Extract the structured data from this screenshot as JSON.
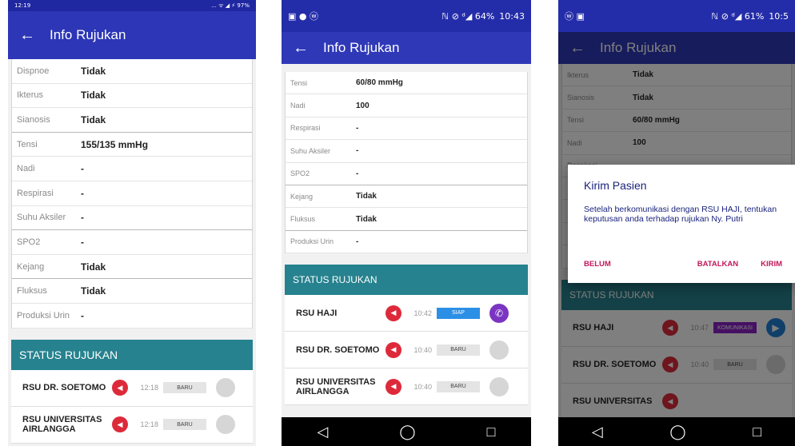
{
  "phone1": {
    "status_time": "12:19",
    "status_right": "... ᯤ ◢ ⚡ 97%",
    "title": "Info Rujukan",
    "rows": [
      {
        "label": "Dispnoe",
        "value": "Tidak"
      },
      {
        "label": "Ikterus",
        "value": "Tidak"
      },
      {
        "label": "Sianosis",
        "value": "Tidak"
      },
      {
        "label": "Tensi",
        "value": "155/135 mmHg"
      },
      {
        "label": "Nadi",
        "value": "-"
      },
      {
        "label": "Respirasi",
        "value": "-"
      },
      {
        "label": "Suhu Aksiler",
        "value": "-"
      },
      {
        "label": "SPO2",
        "value": "-"
      },
      {
        "label": "Kejang",
        "value": "Tidak"
      },
      {
        "label": "Fluksus",
        "value": "Tidak"
      },
      {
        "label": "Produksi Urin",
        "value": "-"
      }
    ],
    "status_header": "STATUS RUJUKAN",
    "hospitals": [
      {
        "name": "RSU DR. SOETOMO",
        "time": "12:18",
        "badge": "BARU"
      },
      {
        "name": "RSU UNIVERSITAS AIRLANGGA",
        "time": "12:18",
        "badge": "BARU"
      }
    ]
  },
  "phone2": {
    "status_time": "10:43",
    "status_left": "▣ ● ⓦ",
    "status_right": "ℕ ⊘ ᵈ◢ 64%",
    "title": "Info Rujukan",
    "rows": [
      {
        "label": "Tensi",
        "value": "60/80 mmHg"
      },
      {
        "label": "Nadi",
        "value": "100"
      },
      {
        "label": "Respirasi",
        "value": "-"
      },
      {
        "label": "Suhu Aksiler",
        "value": "-"
      },
      {
        "label": "SPO2",
        "value": "-"
      },
      {
        "label": "Kejang",
        "value": "Tidak"
      },
      {
        "label": "Fluksus",
        "value": "Tidak"
      },
      {
        "label": "Produksi Urin",
        "value": "-"
      }
    ],
    "status_header": "STATUS RUJUKAN",
    "hospitals": [
      {
        "name": "RSU HAJI",
        "time": "10:42",
        "badge": "SIAP"
      },
      {
        "name": "RSU DR. SOETOMO",
        "time": "10:40",
        "badge": "BARU"
      },
      {
        "name": "RSU UNIVERSITAS AIRLANGGA",
        "time": "10:40",
        "badge": "BARU"
      }
    ],
    "nav": {
      "back": "◁",
      "home": "◯",
      "recent": "□"
    }
  },
  "phone3": {
    "status_time": "10:5",
    "status_left": "ⓦ ▣",
    "status_right": "ℕ ⊘ ᵈ◢ 61%",
    "title": "Info Rujukan",
    "rows": [
      {
        "label": "Ikterus",
        "value": "Tidak"
      },
      {
        "label": "Sianosis",
        "value": "Tidak"
      },
      {
        "label": "Tensi",
        "value": "60/80 mmHg"
      },
      {
        "label": "Nadi",
        "value": "100"
      },
      {
        "label": "Respirasi",
        "value": "-"
      }
    ],
    "status_header": "STATUS RUJUKAN",
    "hospitals": [
      {
        "name": "RSU HAJI",
        "time": "10:47",
        "badge": "KOMUNIKASI"
      },
      {
        "name": "RSU DR. SOETOMO",
        "time": "10:40",
        "badge": "BARU"
      },
      {
        "name": "RSU UNIVERSITAS",
        "time": "",
        "badge": ""
      }
    ],
    "dialog": {
      "title": "Kirim Pasien",
      "body": "Setelah berkomunikasi dengan RSU  HAJI, tentukan keputusan anda terhadap rujukan Ny. Putri",
      "action_later": "BELUM",
      "action_cancel": "BATALKAN",
      "action_send": "KIRIM"
    },
    "nav": {
      "back": "◁",
      "home": "◯",
      "recent": "□"
    }
  }
}
